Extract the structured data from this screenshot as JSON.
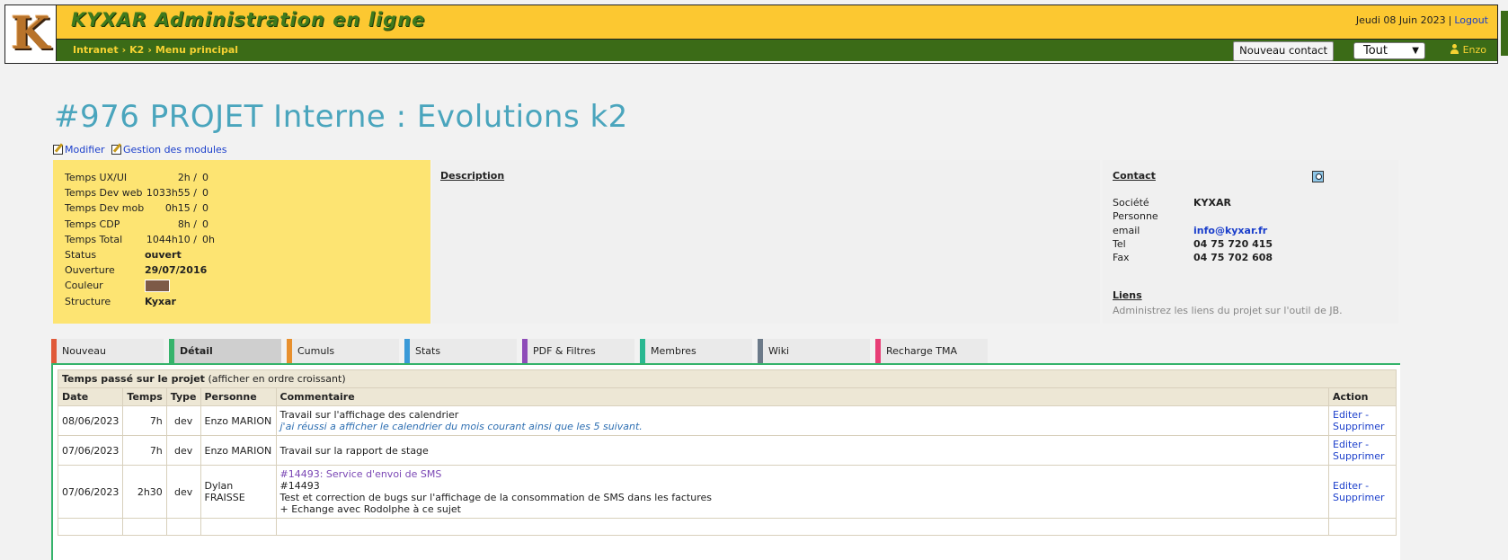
{
  "header": {
    "logo_letter": "K",
    "app_title": "KYXAR Administration en ligne",
    "date": "Jeudi 08 Juin 2023",
    "separator": "|",
    "logout": "Logout",
    "breadcrumb": [
      "Intranet",
      "K2",
      "Menu principal"
    ],
    "breadcrumb_sep": "›",
    "new_contact": "Nouveau contact",
    "filter_value": "Tout",
    "user": "Enzo",
    "colors": {
      "topbar": "#fcc831",
      "navbar": "#3b6b17",
      "title": "#4aa5bd"
    }
  },
  "project": {
    "title": "#976 PROJET Interne : Evolutions k2",
    "actions": [
      "Modifier",
      "Gestion des modules"
    ]
  },
  "info": {
    "rows": [
      {
        "label": "Temps UX/UI",
        "a": "2h /",
        "b": "0"
      },
      {
        "label": "Temps Dev web",
        "a": "1033h55 /",
        "b": "0"
      },
      {
        "label": "Temps Dev mob",
        "a": "0h15 /",
        "b": "0"
      },
      {
        "label": "Temps CDP",
        "a": "8h /",
        "b": "0"
      },
      {
        "label": "Temps Total",
        "a": "1044h10 /",
        "b": "0h"
      }
    ],
    "status_label": "Status",
    "status": "ouvert",
    "ouverture_label": "Ouverture",
    "ouverture": "29/07/2016",
    "couleur_label": "Couleur",
    "couleur": "#7d5a47",
    "structure_label": "Structure",
    "structure": "Kyxar"
  },
  "description": {
    "label": "Description"
  },
  "contact": {
    "label": "Contact",
    "societe_label": "Société",
    "societe": "KYXAR",
    "personne_label": "Personne",
    "personne": "",
    "email_label": "email",
    "email": "info@kyxar.fr",
    "tel_label": "Tel",
    "tel": "04 75 720 415",
    "fax_label": "Fax",
    "fax": "04 75 702 608",
    "liens_label": "Liens",
    "liens_desc": "Administrez les liens du projet sur l'outil de JB."
  },
  "tabs": [
    {
      "label": "Nouveau",
      "color": "#e05a3a"
    },
    {
      "label": "Détail",
      "color": "#35b36b"
    },
    {
      "label": "Cumuls",
      "color": "#e8902e"
    },
    {
      "label": "Stats",
      "color": "#3a9ad8"
    },
    {
      "label": "PDF & Filtres",
      "color": "#8e4cb8"
    },
    {
      "label": "Membres",
      "color": "#2ab891"
    },
    {
      "label": "Wiki",
      "color": "#6c7a89"
    },
    {
      "label": "Recharge TMA",
      "color": "#e83e76"
    }
  ],
  "table": {
    "caption": "Temps passé sur le projet",
    "caption_sub": "(afficher en ordre croissant)",
    "headers": [
      "Date",
      "Temps",
      "Type",
      "Personne",
      "Commentaire",
      "Action"
    ],
    "edit": "Editer -",
    "delete": "Supprimer",
    "rows": [
      {
        "date": "08/06/2023",
        "temps": "7h",
        "type": "dev",
        "personne": "Enzo MARION",
        "c1": "Travail sur l'affichage des calendrier",
        "c2": "j'ai réussi a afficher le calendrier du mois courant ainsi que les 5 suivant."
      },
      {
        "date": "07/06/2023",
        "temps": "7h",
        "type": "dev",
        "personne": "Enzo MARION",
        "c1": "Travail sur la rapport de stage"
      },
      {
        "date": "07/06/2023",
        "temps": "2h30",
        "type": "dev",
        "personne": "Dylan FRAISSE",
        "link": "#14493: Service d'envoi de SMS",
        "c1": "#14493",
        "c2": "Test et correction de bugs sur l'affichage de la consommation de SMS dans les factures",
        "c3": "+ Echange avec Rodolphe à ce sujet"
      }
    ]
  }
}
